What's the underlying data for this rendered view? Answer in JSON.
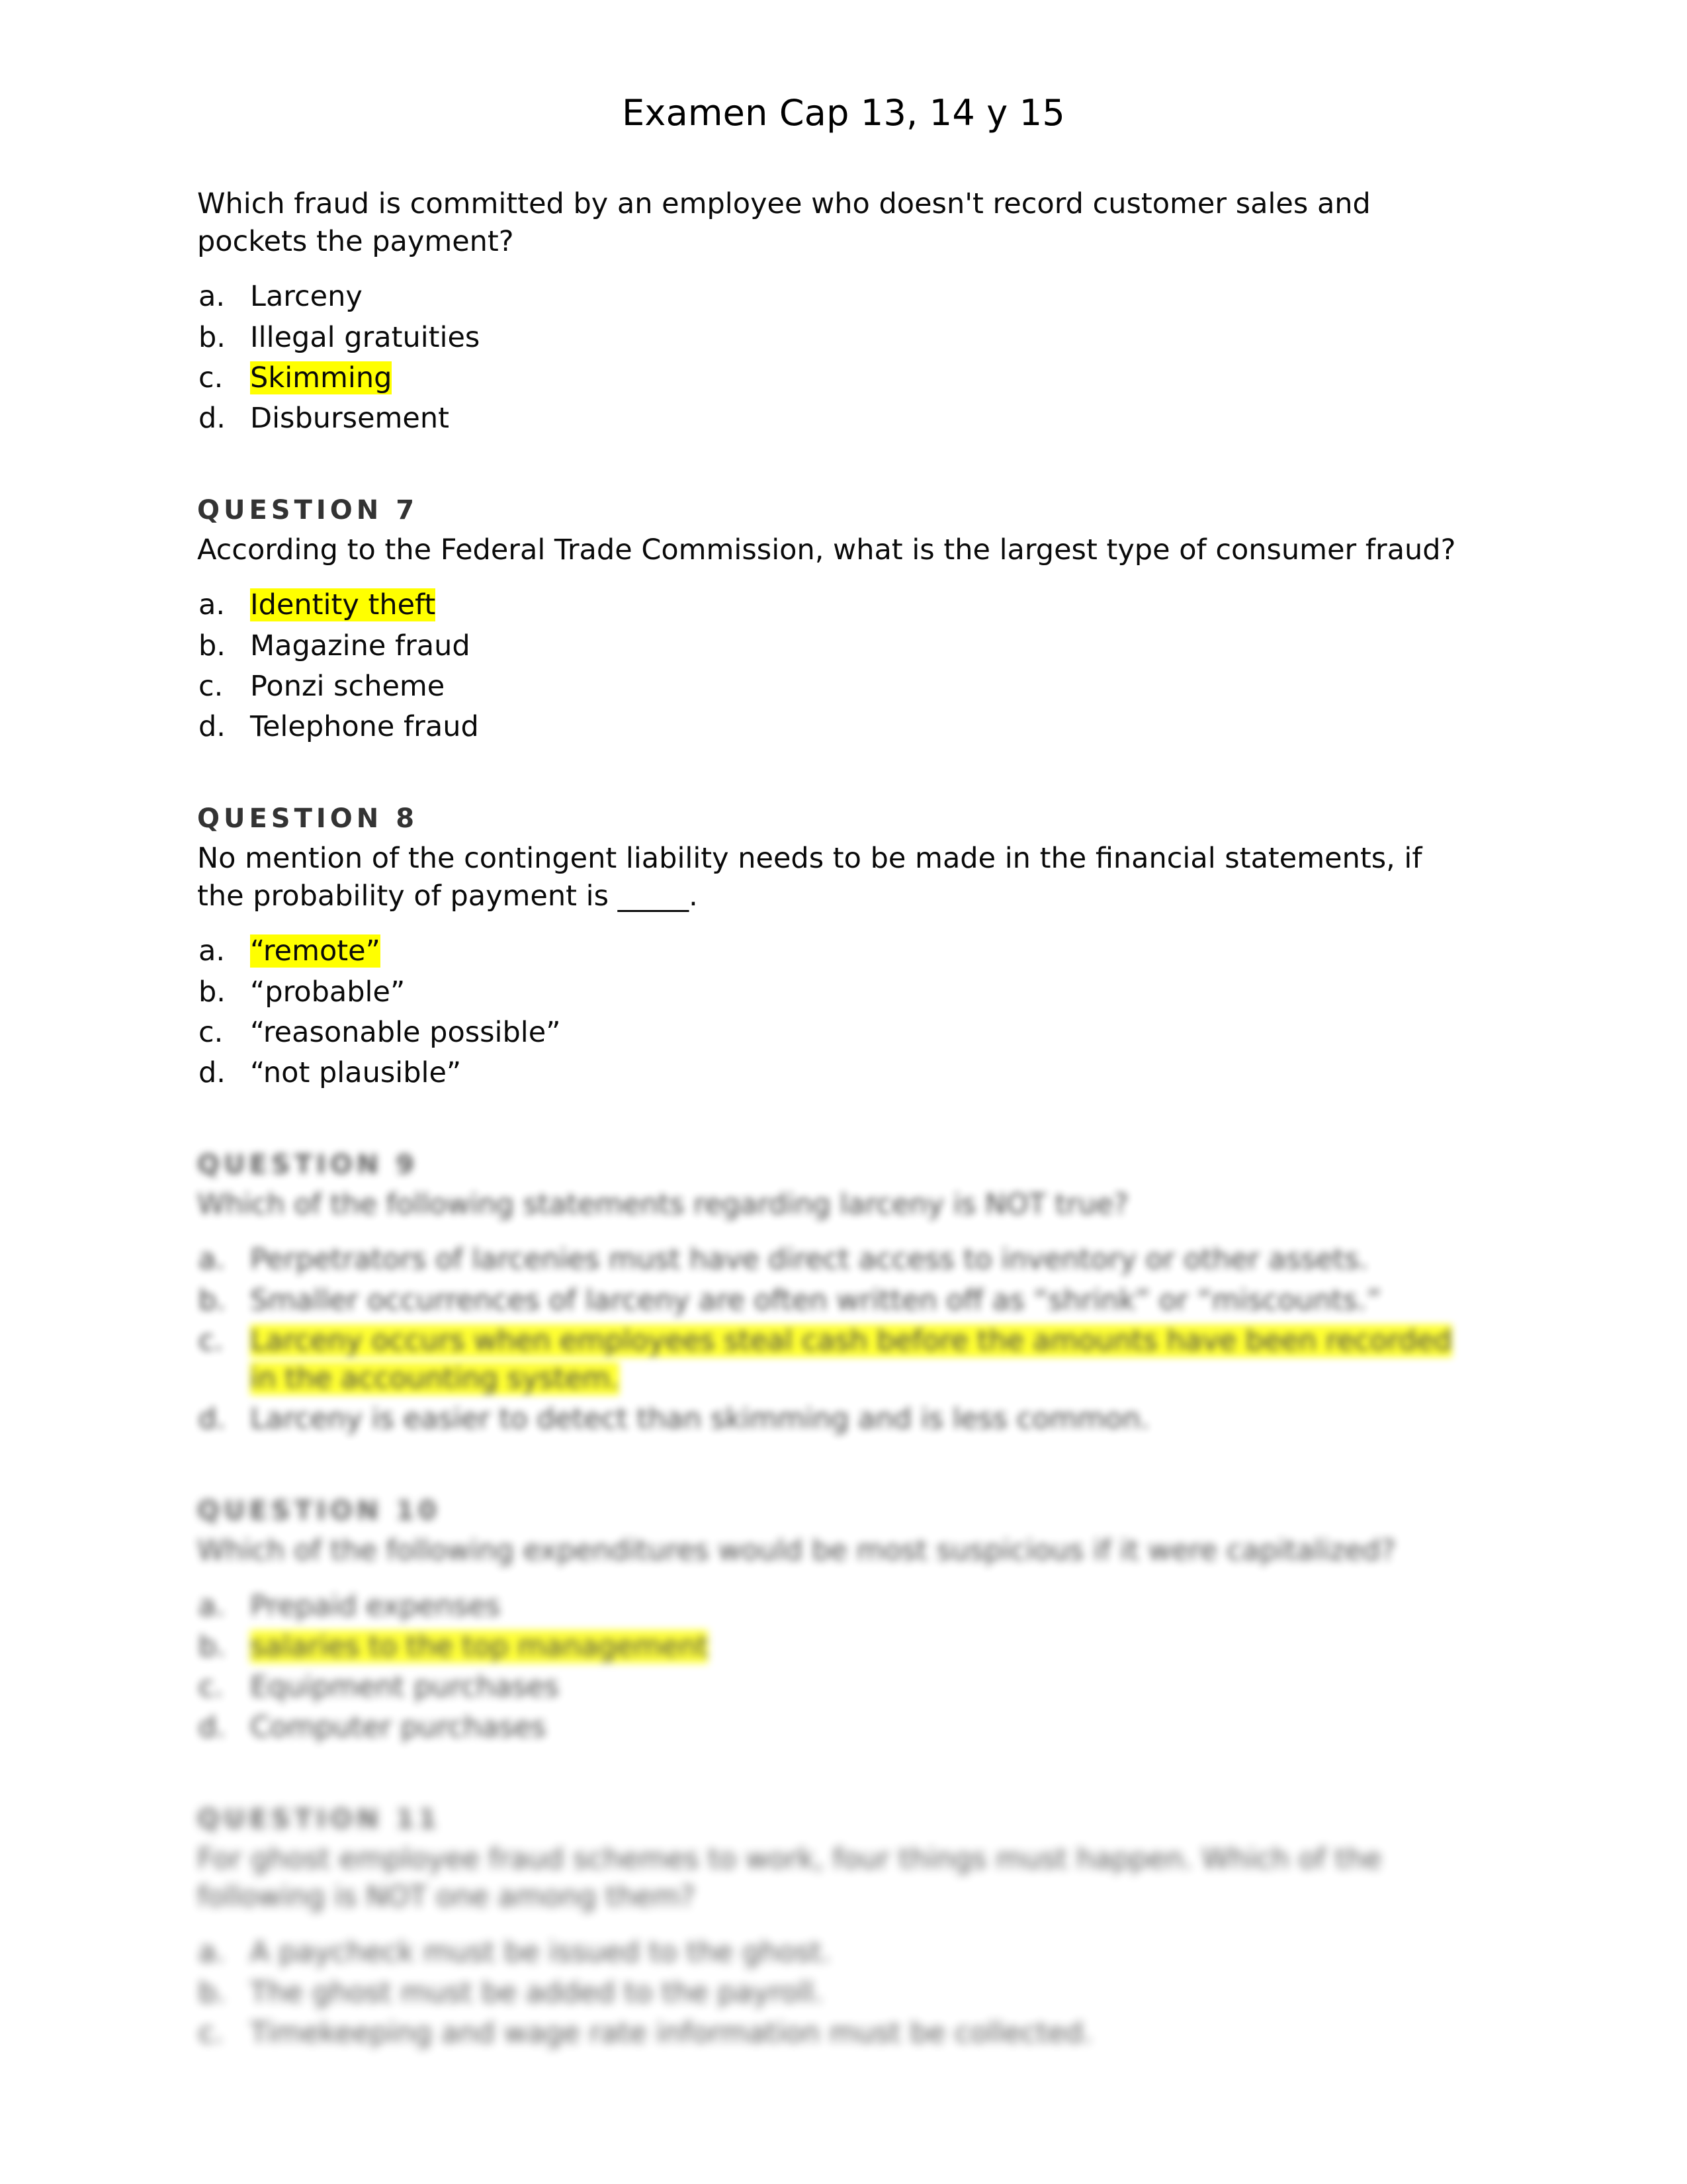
{
  "document": {
    "title": "Examen Cap 13, 14 y 15",
    "highlight_color": "#ffff00",
    "heading_color": "#333333",
    "body_color": "#0a0a0a",
    "page_background": "#ffffff"
  },
  "questions": [
    {
      "heading": "",
      "stem": "Which fraud is committed by an employee who doesn't record customer sales and pockets the payment?",
      "blurred": false,
      "options": [
        {
          "marker": "a.",
          "text": "Larceny",
          "highlighted": false
        },
        {
          "marker": "b.",
          "text": "Illegal gratuities",
          "highlighted": false
        },
        {
          "marker": "c.",
          "text": "Skimming",
          "highlighted": true
        },
        {
          "marker": "d.",
          "text": "Disbursement",
          "highlighted": false
        }
      ]
    },
    {
      "heading": "QUESTION 7",
      "stem": "According to the Federal Trade Commission, what is the largest type of consumer fraud?",
      "blurred": false,
      "options": [
        {
          "marker": "a.",
          "text": "Identity theft",
          "highlighted": true
        },
        {
          "marker": "b.",
          "text": "Magazine fraud",
          "highlighted": false
        },
        {
          "marker": "c.",
          "text": "Ponzi scheme",
          "highlighted": false
        },
        {
          "marker": "d.",
          "text": "Telephone fraud",
          "highlighted": false
        }
      ]
    },
    {
      "heading": "QUESTION 8",
      "stem": "No mention of the contingent liability needs to be made in the financial statements, if the probability of payment is _____.",
      "blurred": false,
      "options": [
        {
          "marker": "a.",
          "text": "“remote”",
          "highlighted": true
        },
        {
          "marker": "b.",
          "text": "“probable”",
          "highlighted": false
        },
        {
          "marker": "c.",
          "text": "“reasonable possible”",
          "highlighted": false
        },
        {
          "marker": "d.",
          "text": "“not plausible”",
          "highlighted": false
        }
      ]
    },
    {
      "heading": "QUESTION 9",
      "stem": "Which of the following statements regarding larceny is NOT true?",
      "blurred": true,
      "blur_level": 1,
      "options": [
        {
          "marker": "a.",
          "text": "Perpetrators of larcenies must have direct access to inventory or other assets.",
          "highlighted": false
        },
        {
          "marker": "b.",
          "text": "Smaller occurrences of larceny are often written off as “shrink” or “miscounts.”",
          "highlighted": false
        },
        {
          "marker": "c.",
          "text": "Larceny occurs when employees steal cash before the amounts have been recorded in the accounting system.",
          "highlighted": true
        },
        {
          "marker": "d.",
          "text": "Larceny is easier to detect than skimming and is less common.",
          "highlighted": false
        }
      ]
    },
    {
      "heading": "QUESTION 10",
      "stem": "Which of the following expenditures would be most suspicious if it were capitalized?",
      "blurred": true,
      "blur_level": 2,
      "options": [
        {
          "marker": "a.",
          "text": "Prepaid expenses",
          "highlighted": false
        },
        {
          "marker": "b.",
          "text": "salaries to the top management",
          "highlighted": true
        },
        {
          "marker": "c.",
          "text": "Equipment purchases",
          "highlighted": false
        },
        {
          "marker": "d.",
          "text": "Computer purchases",
          "highlighted": false
        }
      ]
    },
    {
      "heading": "QUESTION 11",
      "stem": "For ghost employee fraud schemes to work, four things must happen. Which of the following is NOT one among them?",
      "blurred": true,
      "blur_level": 3,
      "options": [
        {
          "marker": "a.",
          "text": "A paycheck must be issued to the ghost.",
          "highlighted": false
        },
        {
          "marker": "b.",
          "text": "The ghost must be added to the payroll.",
          "highlighted": false
        },
        {
          "marker": "c.",
          "text": "Timekeeping and wage rate information must be collected.",
          "highlighted": false
        }
      ]
    }
  ]
}
